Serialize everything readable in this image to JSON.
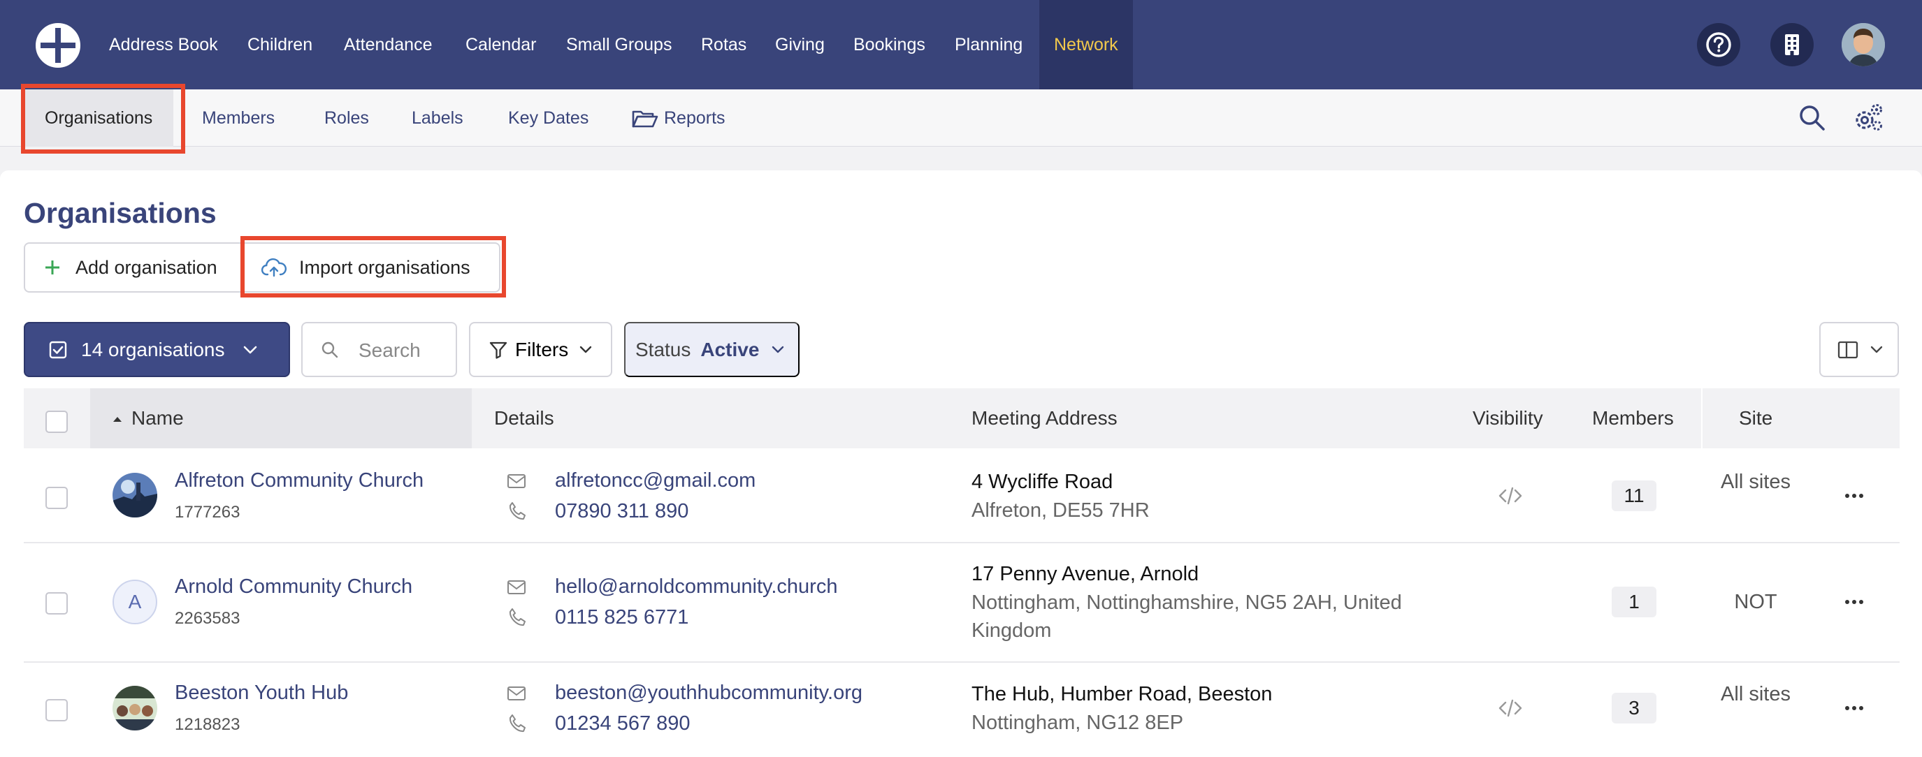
{
  "topnav": {
    "items": [
      "Address Book",
      "Children",
      "Attendance",
      "Calendar",
      "Small Groups",
      "Rotas",
      "Giving",
      "Bookings",
      "Planning",
      "Network"
    ],
    "active": "Network"
  },
  "subnav": {
    "items": [
      "Organisations",
      "Members",
      "Roles",
      "Labels",
      "Key Dates",
      "Reports"
    ],
    "active": "Organisations"
  },
  "page": {
    "title": "Organisations",
    "add_label": "Add organisation",
    "import_label": "Import organisations"
  },
  "toolbar": {
    "count_label": "14 organisations",
    "search_placeholder": "Search",
    "filters_label": "Filters",
    "status_label": "Status",
    "status_value": "Active"
  },
  "table": {
    "columns": [
      "Name",
      "Details",
      "Meeting Address",
      "Visibility",
      "Members",
      "Site"
    ],
    "rows": [
      {
        "name": "Alfreton Community Church",
        "id": "1777263",
        "email": "alfretoncc@gmail.com",
        "phone": "07890 311 890",
        "address_line1": "4 Wycliffe Road",
        "address_line2": "Alfreton, DE55 7HR",
        "members": "11",
        "site": "All sites"
      },
      {
        "name": "Arnold Community Church",
        "id": "2263583",
        "avatar_letter": "A",
        "email": "hello@arnoldcommunity.church",
        "phone": "0115 825 6771",
        "address_line1": "17 Penny Avenue, Arnold",
        "address_line2": "Nottingham, Nottinghamshire, NG5 2AH, United Kingdom",
        "members": "1",
        "site": "NOT"
      },
      {
        "name": "Beeston Youth Hub",
        "id": "1218823",
        "email": "beeston@youthhubcommunity.org",
        "phone": "01234 567 890",
        "address_line1": "The Hub, Humber Road, Beeston",
        "address_line2": "Nottingham, NG12 8EP",
        "members": "3",
        "site": "All sites"
      }
    ]
  },
  "colors": {
    "brand": "#39447a",
    "active_nav": "#f2c94c",
    "highlight": "#e8472e"
  }
}
